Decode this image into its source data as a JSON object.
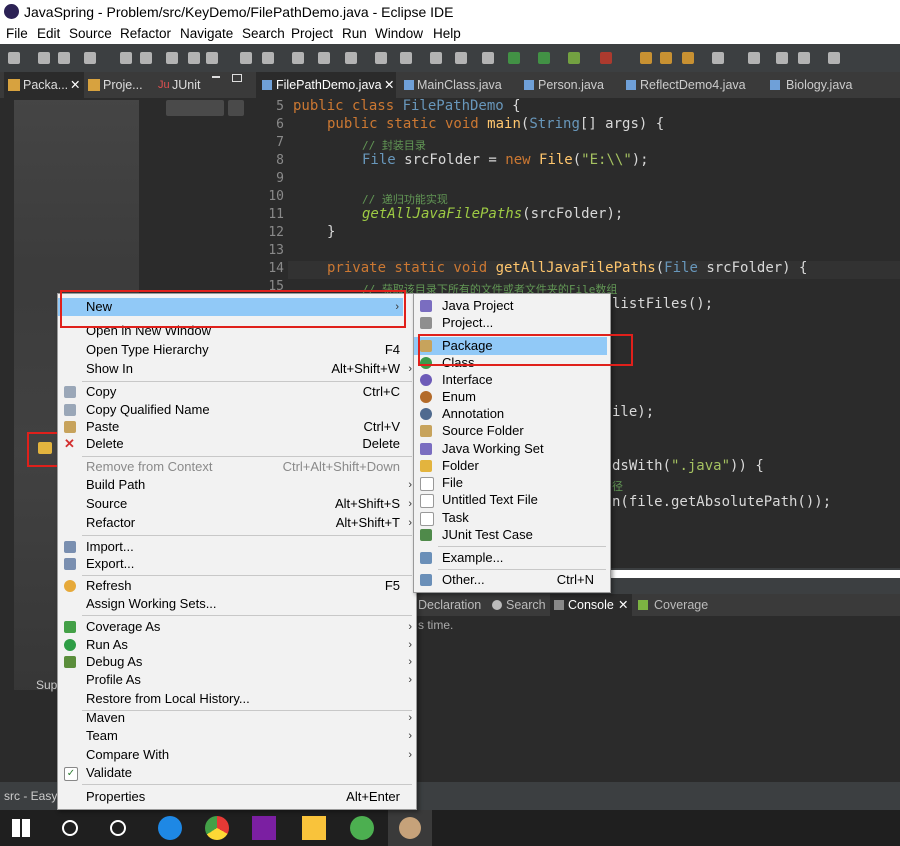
{
  "window": {
    "title": "JavaSpring - Problem/src/KeyDemo/FilePathDemo.java - Eclipse IDE"
  },
  "menubar": [
    "File",
    "Edit",
    "Source",
    "Refactor",
    "Navigate",
    "Search",
    "Project",
    "Run",
    "Window",
    "Help"
  ],
  "left_tabs": [
    "Packa...",
    "Proje...",
    "JUnit"
  ],
  "editor_tabs": [
    "FilePathDemo.java",
    "MainClass.java",
    "Person.java",
    "ReflectDemo4.java",
    "Biology.java"
  ],
  "code": {
    "line_numbers": [
      "5",
      "6",
      "7",
      "8",
      "9",
      "10",
      "11",
      "12",
      "13",
      "14",
      "15"
    ],
    "l5": {
      "kw": "public class ",
      "name": "FilePathDemo",
      "rest": " {"
    },
    "l6": {
      "kw": "public static void ",
      "fn": "main",
      "p1": "(",
      "ty": "String",
      "p2": "[] args) {"
    },
    "l7": {
      "cm": "// 封装目录"
    },
    "l8": {
      "ty": "File",
      "v": " srcFolder = ",
      "kw": "new ",
      "fn": "File",
      "p": "(",
      "st": "\"E:\\\\\"",
      "end": ");"
    },
    "l10": {
      "cm": "// 递归功能实现"
    },
    "l11": {
      "it": "getAllJavaFilePaths",
      "rest": "(srcFolder);"
    },
    "l12": {
      "rest": "}"
    },
    "l14": {
      "kw": "private static void ",
      "fn": "getAllJavaFilePaths",
      "p": "(",
      "ty": "File",
      "rest": " srcFolder) {"
    },
    "l15": {
      "cm": "// 获取该目录下所有的文件或者文件夹的File数组"
    },
    "frag1": "listFiles();",
    "frag2": "ile);",
    "frag3_a": "dsWith(",
    "frag3_b": "\".java\"",
    "frag3_c": ")) {",
    "frag4": "径",
    "frag5": "n(file.getAbsolutePath());"
  },
  "bottom_tabs": [
    "Declaration",
    "Search",
    "Console",
    "Coverage"
  ],
  "console_text": "s time.",
  "status_text": "src - Easy",
  "left_partial": "Sup",
  "context_menu": {
    "items": [
      {
        "label": "New",
        "shortcut": "",
        "arrow": true,
        "icon": "",
        "highlight": true
      },
      {
        "label": "Open in New Window",
        "shortcut": ""
      },
      {
        "label": "Open Type Hierarchy",
        "shortcut": "F4"
      },
      {
        "label": "Show In",
        "shortcut": "Alt+Shift+W",
        "arrow": true
      },
      {
        "label": "Copy",
        "shortcut": "Ctrl+C",
        "icon": "copy-icon"
      },
      {
        "label": "Copy Qualified Name",
        "shortcut": "",
        "icon": "copy-icon"
      },
      {
        "label": "Paste",
        "shortcut": "Ctrl+V",
        "icon": "paste-icon"
      },
      {
        "label": "Delete",
        "shortcut": "Delete",
        "icon": "delete-icon"
      },
      {
        "label": "Remove from Context",
        "shortcut": "Ctrl+Alt+Shift+Down",
        "disabled": true
      },
      {
        "label": "Build Path",
        "shortcut": "",
        "arrow": true
      },
      {
        "label": "Source",
        "shortcut": "Alt+Shift+S",
        "arrow": true
      },
      {
        "label": "Refactor",
        "shortcut": "Alt+Shift+T",
        "arrow": true
      },
      {
        "label": "Import...",
        "shortcut": "",
        "icon": "import-icon"
      },
      {
        "label": "Export...",
        "shortcut": "",
        "icon": "export-icon"
      },
      {
        "label": "Refresh",
        "shortcut": "F5",
        "icon": "refresh-icon"
      },
      {
        "label": "Assign Working Sets...",
        "shortcut": ""
      },
      {
        "label": "Coverage As",
        "shortcut": "",
        "arrow": true,
        "icon": "coverage-icon"
      },
      {
        "label": "Run As",
        "shortcut": "",
        "arrow": true,
        "icon": "run-icon"
      },
      {
        "label": "Debug As",
        "shortcut": "",
        "arrow": true,
        "icon": "debug-icon"
      },
      {
        "label": "Profile As",
        "shortcut": "",
        "arrow": true
      },
      {
        "label": "Restore from Local History...",
        "shortcut": ""
      },
      {
        "label": "Maven",
        "shortcut": "",
        "arrow": true
      },
      {
        "label": "Team",
        "shortcut": "",
        "arrow": true
      },
      {
        "label": "Compare With",
        "shortcut": "",
        "arrow": true
      },
      {
        "label": "Validate",
        "shortcut": "",
        "icon": "check-icon"
      },
      {
        "label": "Properties",
        "shortcut": "Alt+Enter"
      }
    ]
  },
  "submenu": {
    "items": [
      {
        "label": "Java Project",
        "icon": "java-project-icon"
      },
      {
        "label": "Project...",
        "icon": "project-icon"
      },
      {
        "label": "Package",
        "icon": "package-icon",
        "highlight": true
      },
      {
        "label": "Class",
        "icon": "class-icon"
      },
      {
        "label": "Interface",
        "icon": "interface-icon"
      },
      {
        "label": "Enum",
        "icon": "enum-icon"
      },
      {
        "label": "Annotation",
        "icon": "annotation-icon"
      },
      {
        "label": "Source Folder",
        "icon": "source-folder-icon"
      },
      {
        "label": "Java Working Set",
        "icon": "working-set-icon"
      },
      {
        "label": "Folder",
        "icon": "folder-icon"
      },
      {
        "label": "File",
        "icon": "file-icon"
      },
      {
        "label": "Untitled Text File",
        "icon": "text-file-icon"
      },
      {
        "label": "Task",
        "icon": "task-icon"
      },
      {
        "label": "JUnit Test Case",
        "icon": "junit-icon"
      },
      {
        "label": "Example...",
        "icon": "example-icon"
      },
      {
        "label": "Other...",
        "icon": "other-icon",
        "shortcut": "Ctrl+N"
      }
    ]
  },
  "colors": {
    "highlight": "#91c9f7",
    "annotation_red": "#e0201b",
    "editor_bg": "#2b2b2b"
  }
}
